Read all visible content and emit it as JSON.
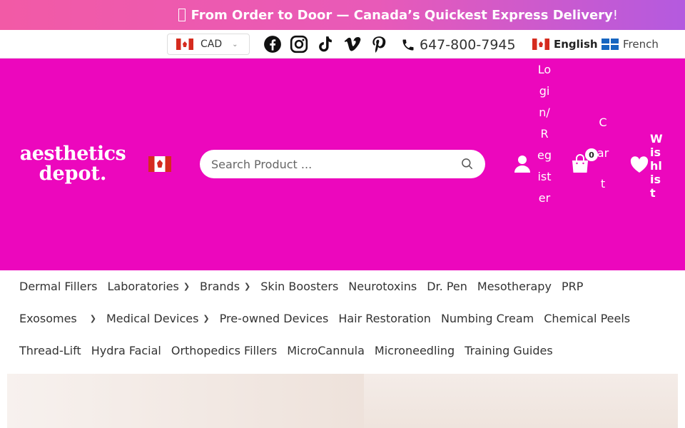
{
  "promo": {
    "text": "From Order to Door — Canada’s Quickest Express Delivery",
    "bang": "!"
  },
  "topbar": {
    "currency": "CAD",
    "phone": "647-800-7945",
    "lang_en": "English",
    "lang_fr": "French",
    "social": [
      "facebook-icon",
      "instagram-icon",
      "tiktok-icon",
      "vimeo-icon",
      "pinterest-icon"
    ]
  },
  "header": {
    "logo_line1": "aesthetics",
    "logo_line2": "depot.",
    "search_placeholder": "Search Product ...",
    "login_label": "Login/Register",
    "cart_label": "Cart",
    "cart_count": "0",
    "wishlist_label": "Wishlist",
    "brand_color": "#ec07bd"
  },
  "nav": {
    "row1": [
      {
        "label": "Dermal Fillers",
        "dropdown": false
      },
      {
        "label": "Laboratories",
        "dropdown": true
      },
      {
        "label": "Brands",
        "dropdown": true
      },
      {
        "label": "Skin Boosters",
        "dropdown": false
      },
      {
        "label": "Neurotoxins",
        "dropdown": false
      },
      {
        "label": "Dr. Pen",
        "dropdown": false
      },
      {
        "label": "Mesotherapy",
        "dropdown": false
      },
      {
        "label": "PRP",
        "dropdown": false
      }
    ],
    "row2": [
      {
        "label": "Exosomes",
        "dropdown": true
      },
      {
        "label": "Medical Devices",
        "dropdown": true
      },
      {
        "label": "Pre-owned Devices",
        "dropdown": false
      },
      {
        "label": "Hair Restoration",
        "dropdown": false
      },
      {
        "label": "Numbing Cream",
        "dropdown": false
      },
      {
        "label": "Chemical Peels",
        "dropdown": false
      }
    ],
    "row3": [
      {
        "label": "Thread-Lift",
        "dropdown": false
      },
      {
        "label": "Hydra Facial",
        "dropdown": false
      },
      {
        "label": "Orthopedics Fillers",
        "dropdown": false
      },
      {
        "label": "MicroCannula",
        "dropdown": false
      },
      {
        "label": "Microneedling",
        "dropdown": false
      },
      {
        "label": "Training Guides",
        "dropdown": false
      }
    ]
  }
}
